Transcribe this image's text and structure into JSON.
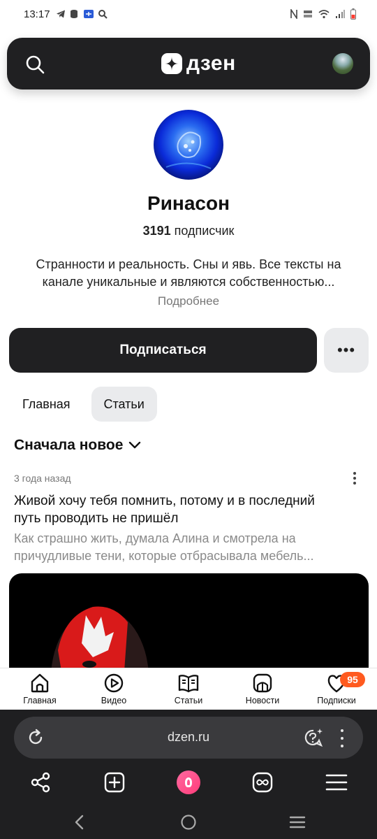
{
  "status_bar": {
    "time": "13:17"
  },
  "header": {
    "logo_text": "дзен"
  },
  "channel": {
    "name": "Ринасон",
    "subscribers_count": "3191",
    "subscribers_label": "подписчик",
    "description_line1": "Странности и реальность. Сны и явь. Все тексты на",
    "description_line2": "канале уникальные и являются собственностью...",
    "more_link": "Подробнее",
    "subscribe_button": "Подписаться",
    "more_button": "•••"
  },
  "tabs": [
    {
      "label": "Главная",
      "active": false
    },
    {
      "label": "Статьи",
      "active": true
    }
  ],
  "sort": {
    "label": "Сначала новое"
  },
  "article": {
    "time": "3 года назад",
    "title_line1": "Живой хочу тебя помнить, потому и в последний",
    "title_line2": "путь проводить не пришёл",
    "snippet_line1": "Как страшно жить, думала Алина и смотрела на",
    "snippet_line2": "причудливые тени, которые отбрасывала мебель..."
  },
  "app_nav": {
    "items": [
      {
        "label": "Главная",
        "icon": "home-icon"
      },
      {
        "label": "Видео",
        "icon": "video-icon"
      },
      {
        "label": "Статьи",
        "icon": "articles-icon"
      },
      {
        "label": "Новости",
        "icon": "news-icon"
      },
      {
        "label": "Подписки",
        "icon": "subscriptions-icon"
      }
    ],
    "subscriptions_badge": "95"
  },
  "browser": {
    "url": "dzen.ru"
  },
  "colors": {
    "header_bg": "#202022",
    "badge": "#ff5a1f",
    "alice": "#ff3c7a",
    "browser_bg": "#1f1f21"
  }
}
